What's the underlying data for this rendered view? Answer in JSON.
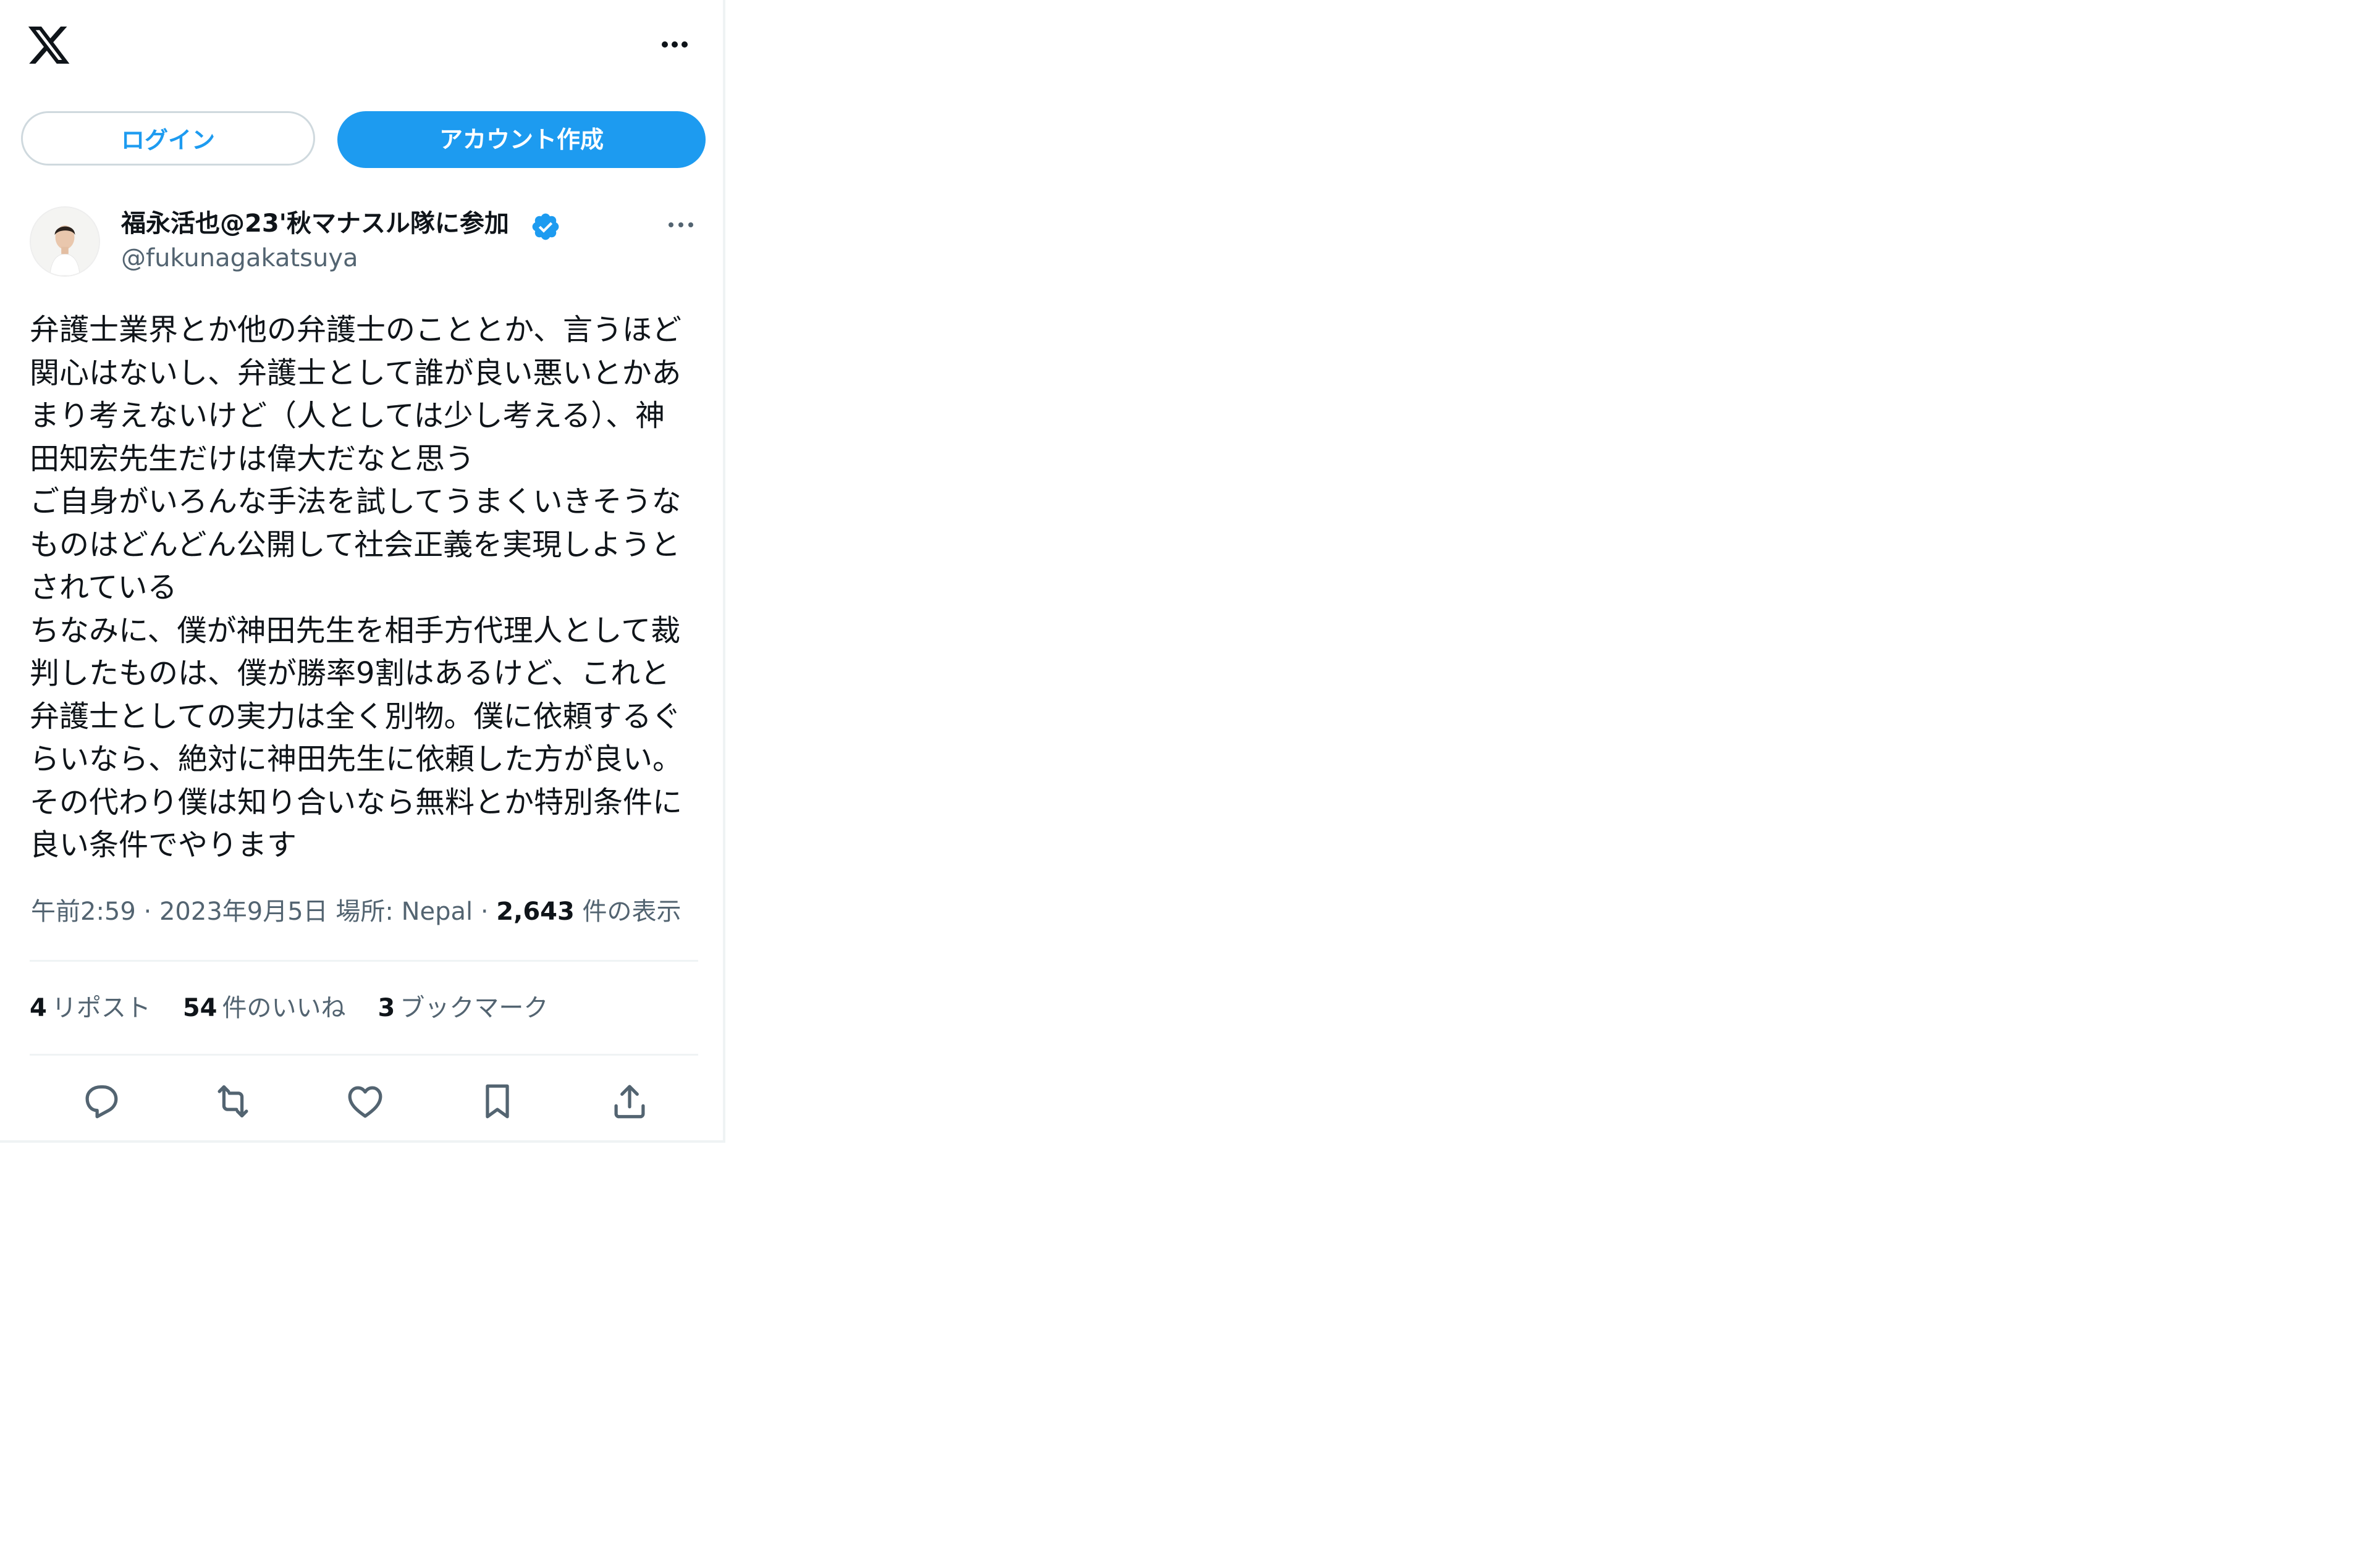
{
  "header": {
    "logo_icon": "x-logo-icon",
    "more_icon": "more-horizontal-icon"
  },
  "auth": {
    "login_label": "ログイン",
    "signup_label": "アカウント作成"
  },
  "author": {
    "display_name": "福永活也@23'秋マナスル隊に参加",
    "handle": "@fukunagakatsuya",
    "verified": true,
    "verified_color": "#1d9bf0"
  },
  "tweet": {
    "lines": [
      "弁護士業界とか他の弁護士のこととか、言うほど",
      "関心はないし、弁護士として誰が良い悪いとかあ",
      "まり考えないけど（人としては少し考える）、神",
      "田知宏先生だけは偉大だなと思う",
      "ご自身がいろんな手法を試してうまくいきそうな",
      "ものはどんどん公開して社会正義を実現しようと",
      "されている",
      "ちなみに、僕が神田先生を相手方代理人として裁",
      "判したものは、僕が勝率9割はあるけど、これと",
      "弁護士としての実力は全く別物。僕に依頼するぐ",
      "らいなら、絶対に神田先生に依頼した方が良い。",
      "その代わり僕は知り合いなら無料とか特別条件に",
      "良い条件でやります"
    ]
  },
  "meta": {
    "time": "午前2:59",
    "separator1": " · ",
    "date": "2023年9月5日",
    "location": " 場所: Nepal",
    "separator2": " · ",
    "views_count": "2,643",
    "views_label": " 件の表示"
  },
  "stats": {
    "reposts_count": "4",
    "reposts_label": "リポスト",
    "likes_count": "54",
    "likes_label": "件のいいね",
    "bookmarks_count": "3",
    "bookmarks_label": "ブックマーク"
  },
  "actions": {
    "reply_icon": "reply-icon",
    "repost_icon": "repost-icon",
    "like_icon": "heart-icon",
    "bookmark_icon": "bookmark-icon",
    "share_icon": "share-icon"
  },
  "colors": {
    "accent": "#1d9bf0",
    "text_primary": "#0f1419",
    "text_secondary": "#536471",
    "divider": "#eff3f4"
  }
}
